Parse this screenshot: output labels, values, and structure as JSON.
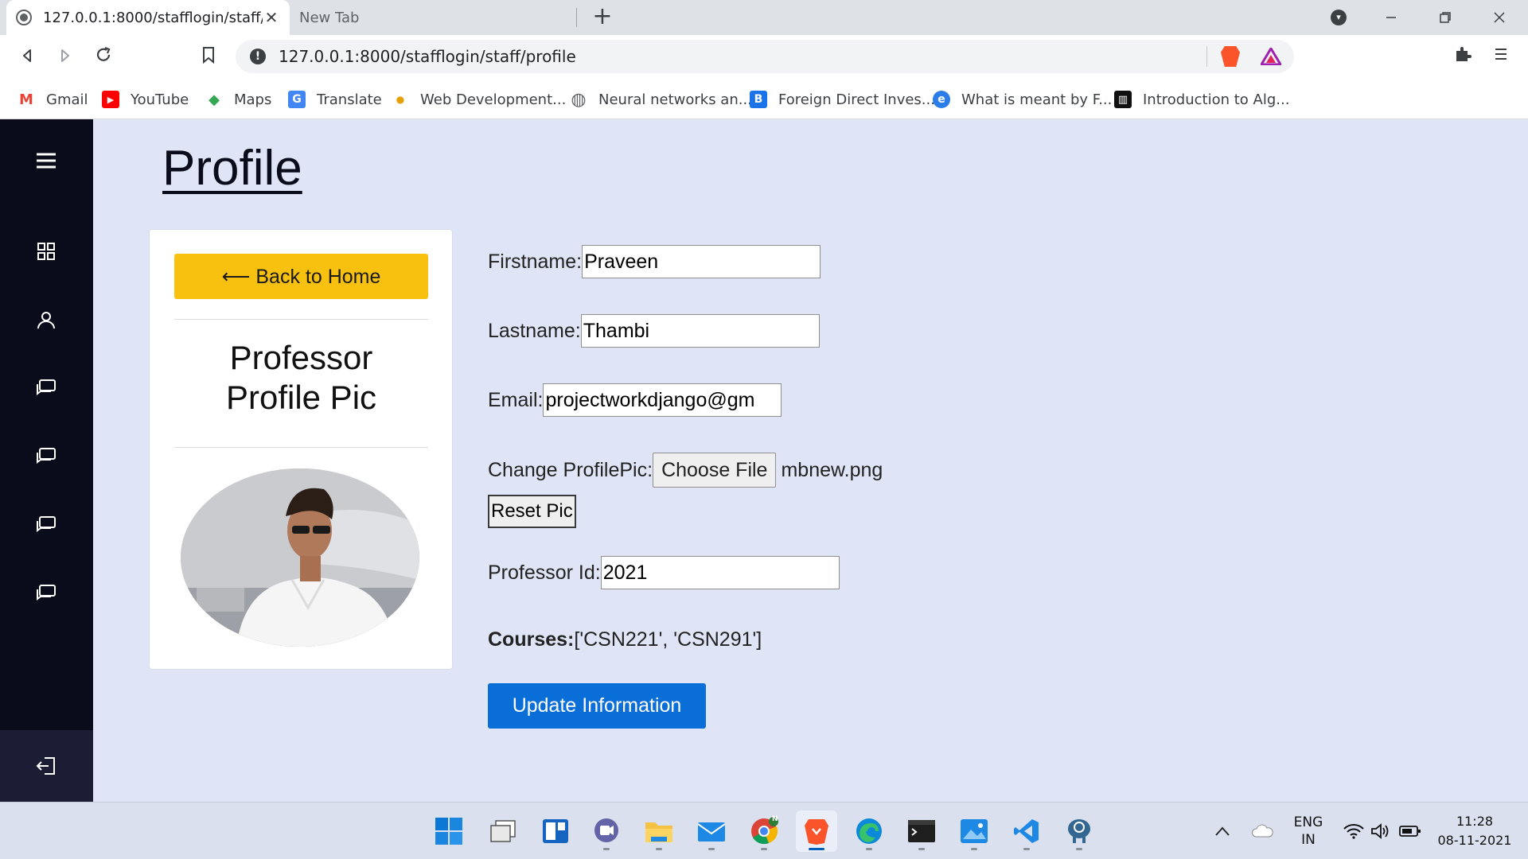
{
  "browser": {
    "active_tab_title": "127.0.0.1:8000/stafflogin/staff/profile",
    "inactive_tab_title": "New Tab",
    "close_glyph": "✕",
    "new_tab_glyph": "+",
    "url": "127.0.0.1:8000/stafflogin/staff/profile",
    "info_glyph": "!",
    "bookmarks": [
      {
        "label": "Gmail",
        "icon": "gmail-icon",
        "glyph": "M",
        "color": "#ea4335"
      },
      {
        "label": "YouTube",
        "icon": "youtube-icon",
        "glyph": "▶",
        "color": "#ff0000"
      },
      {
        "label": "Maps",
        "icon": "maps-icon",
        "glyph": "◆",
        "color": "#34a853"
      },
      {
        "label": "Translate",
        "icon": "translate-icon",
        "glyph": "G",
        "color": "#4285f4"
      },
      {
        "label": "Web Development...",
        "icon": "webdev-icon",
        "glyph": "●",
        "color": "#e6a100"
      },
      {
        "label": "Neural networks an...",
        "icon": "globe-icon",
        "glyph": "◍",
        "color": "#5f6368"
      },
      {
        "label": "Foreign Direct Inves...",
        "icon": "b-icon",
        "glyph": "B",
        "color": "#1a73e8"
      },
      {
        "label": "What is meant by F...",
        "icon": "e-icon",
        "glyph": "e",
        "color": "#2b7de9"
      },
      {
        "label": "Introduction to Alg...",
        "icon": "book-icon",
        "glyph": "▥",
        "color": "#111111"
      }
    ]
  },
  "page": {
    "title": "Profile",
    "back_button": "⟵ Back to Home",
    "card_heading_line1": "Professor",
    "card_heading_line2": "Profile Pic",
    "form": {
      "firstname_label": "Firstname:",
      "firstname_value": "Praveen",
      "lastname_label": "Lastname:",
      "lastname_value": "Thambi",
      "email_label": "Email:",
      "email_value": "projectworkdjango@gm",
      "profilepic_label": "Change ProfilePic:",
      "choose_file_label": "Choose File",
      "file_name": "mbnew.png",
      "reset_label": "Reset Pic",
      "professor_id_label": "Professor Id:",
      "professor_id_value": "2021",
      "courses_label": "Courses:",
      "courses_value": "['CSN221', 'CSN291']",
      "update_label": "Update Information"
    }
  },
  "taskbar": {
    "language_line1": "ENG",
    "language_line2": "IN",
    "time": "11:28",
    "date": "08-11-2021",
    "chrome_badge": "N"
  },
  "colors": {
    "sidebar": "#0a0c1b",
    "page_bg": "#dfe5f6",
    "back_button": "#f9c10f",
    "update_button": "#0a6ed8"
  }
}
